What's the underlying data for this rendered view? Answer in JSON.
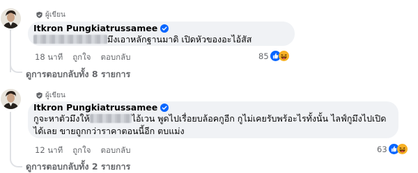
{
  "comments": [
    {
      "badge": "ผู้เขียน",
      "author": "Itkron Pungkiatrussamee",
      "text_lines": [
        "มึงเอาหลักฐานมาดิ เปิดหัวของอะไอ้สัส"
      ],
      "time": "18 นาที",
      "like_label": "ถูกใจ",
      "reply_label": "ตอบกลับ",
      "reaction_count": "85",
      "reaction_icons": [
        "like-reaction-icon",
        "haha-reaction-icon"
      ],
      "view_replies": "ดูการตอบกลับทั้ง 8 รายการ"
    },
    {
      "badge": "ผู้เขียน",
      "author": "Itkron Pungkiatrussamee",
      "text_lines": [
        "กูจะหาตัวมึงให้",
        "ไอ้เวน พูดไปเรื่อยบล้อคกูอีก กูไม่เคยรับพร้อะไรทั้งนั้น ไลฟ์กูมึงไปเปิด",
        "ได้เลย ขายถูกกว่าราคาตอนนี้อีก ตบแม่ง"
      ],
      "time": "12 นาที",
      "like_label": "ถูกใจ",
      "reply_label": "ตอบกลับ",
      "reaction_count": "63",
      "reaction_icons": [
        "like-reaction-icon",
        "haha-reaction-icon"
      ],
      "view_replies": "ดูการตอบกลับทั้ง 2 รายการ"
    }
  ],
  "colors": {
    "bubble": "#f0f2f5",
    "secondary_text": "#65676b",
    "verified": "#0866ff",
    "like": "#0866ff",
    "haha": "#f7b125"
  }
}
